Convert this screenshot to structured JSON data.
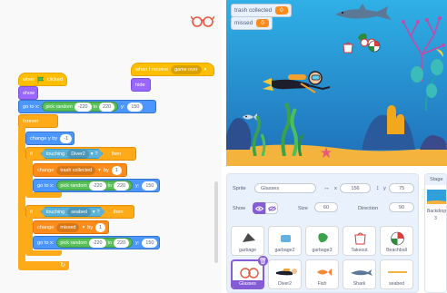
{
  "code": {
    "green_flag_stack": {
      "hat": "when",
      "hat_end": "clicked",
      "show": "show",
      "goto_label": "go to x:",
      "random_label": "pick random",
      "random_from": "-220",
      "random_to": "220",
      "y_label": "y:",
      "y_value": "150",
      "forever": "forever",
      "change_y_label": "change y by",
      "change_y_value": "-1",
      "if1_label": "if",
      "touching_label": "touching",
      "touching1_target": "Diver2",
      "q_mark": "?",
      "then_label": "then",
      "change_var_label": "change",
      "var1_name": "trash collected",
      "by_label": "by",
      "var1_value": "1",
      "goto2_label": "go to x:",
      "random2_label": "pick random",
      "random2_from": "-220",
      "random2_to": "220",
      "y2_label": "y:",
      "y2_value": "150",
      "if2_label": "if",
      "touching2_label": "touching",
      "touching2_target": "seabed",
      "q_mark2": "?",
      "then2_label": "then",
      "change2_label": "change",
      "var2_name": "missed",
      "by2_label": "by",
      "var2_value": "1",
      "goto3_label": "go to x:",
      "random3_label": "pick random",
      "random3_from": "-220",
      "random3_to": "220",
      "y3_label": "y:",
      "y3_value": "150"
    },
    "receive_stack": {
      "hat": "when I receive",
      "message": "game over",
      "hide": "hide"
    }
  },
  "stage": {
    "monitors": [
      {
        "label": "trash collected",
        "value": "0"
      },
      {
        "label": "missed",
        "value": "0"
      }
    ]
  },
  "sprite_info": {
    "sprite_label": "Sprite",
    "sprite_name": "Glasses",
    "x_label": "x",
    "x_value": "156",
    "y_label": "y",
    "y_value": "75",
    "show_label": "Show",
    "size_label": "Size",
    "size_value": "60",
    "direction_label": "Direction",
    "direction_value": "90",
    "sprites": [
      "garbage",
      "garbage2",
      "garbage3",
      "Takeout",
      "Beachball",
      "Glasses",
      "Diver2",
      "Fish",
      "Shark",
      "seabed"
    ],
    "selected_sprite": "Glasses"
  },
  "stage_selector": {
    "title": "Stage",
    "backdrops_label": "Backdrop",
    "backdrops_count": "3"
  },
  "colors": {
    "events": "#ffbf00",
    "control": "#ffab19",
    "motion": "#4c97ff",
    "looks": "#9966ff",
    "sensing": "#5cb1d6",
    "variables": "#ff8c1a",
    "operators": "#59c059",
    "selection": "#855cd6"
  }
}
